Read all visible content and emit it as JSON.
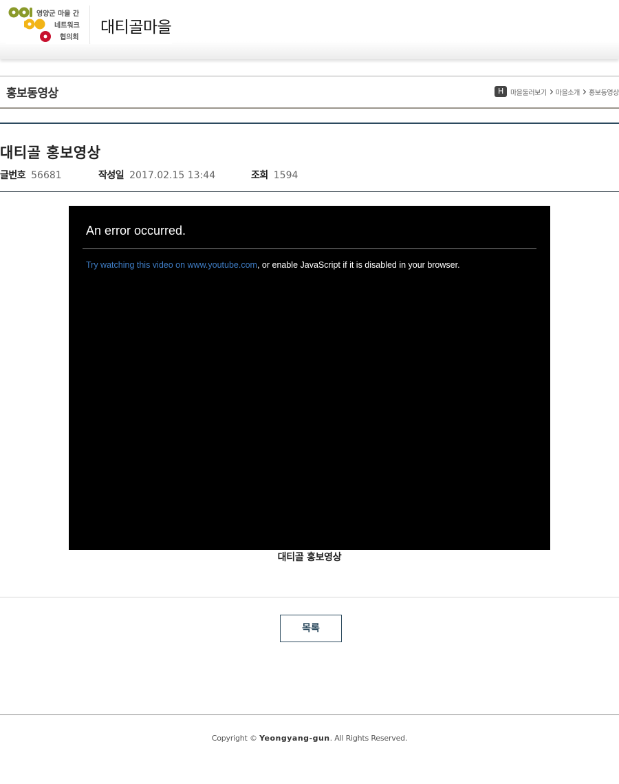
{
  "header": {
    "logo_lines": [
      "영양군 마을 간",
      "네트워크",
      "협의회"
    ],
    "village_name": "대티골마을"
  },
  "subheader": {
    "page_heading": "홍보동영상",
    "home_glyph": "H",
    "breadcrumb": [
      "마을둘러보기",
      "마을소개",
      "홍보동영상"
    ]
  },
  "post": {
    "title": "대티골 홍보영상",
    "meta": {
      "number_label": "글번호",
      "number_value": "56681",
      "date_label": "작성일",
      "date_value": "2017.02.15 13:44",
      "views_label": "조회",
      "views_value": "1594"
    },
    "video": {
      "error_title": "An error occurred.",
      "error_link": "Try watching this video on www.youtube.com",
      "error_rest": ", or enable JavaScript if it is disabled in your browser."
    },
    "caption": "대티골 홍보영상"
  },
  "actions": {
    "list_button": "목록"
  },
  "footer": {
    "prefix": "Copyright © ",
    "brand": "Yeongyang-gun",
    "suffix": ". All Rights Reserved."
  },
  "colors": {
    "navy_accent": "#2c4a5e",
    "link_blue": "#3f7ec7",
    "logo_green": "#8a9a2a",
    "logo_yellow": "#f2b416",
    "logo_red": "#c8102e"
  }
}
